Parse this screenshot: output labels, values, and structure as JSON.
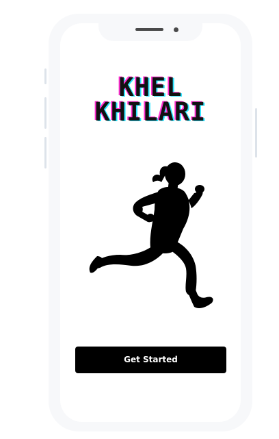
{
  "app": {
    "title_line1": "KHEL",
    "title_line2": "KHILARI"
  },
  "hero": {
    "image": "running-woman-silhouette"
  },
  "actions": {
    "get_started_label": "Get Started"
  },
  "colors": {
    "button_bg": "#000000",
    "button_text": "#ffffff",
    "title_glitch_magenta": "#ff2fd1",
    "title_glitch_cyan": "#2be4ff",
    "device_frame": "#f7f8fa"
  }
}
